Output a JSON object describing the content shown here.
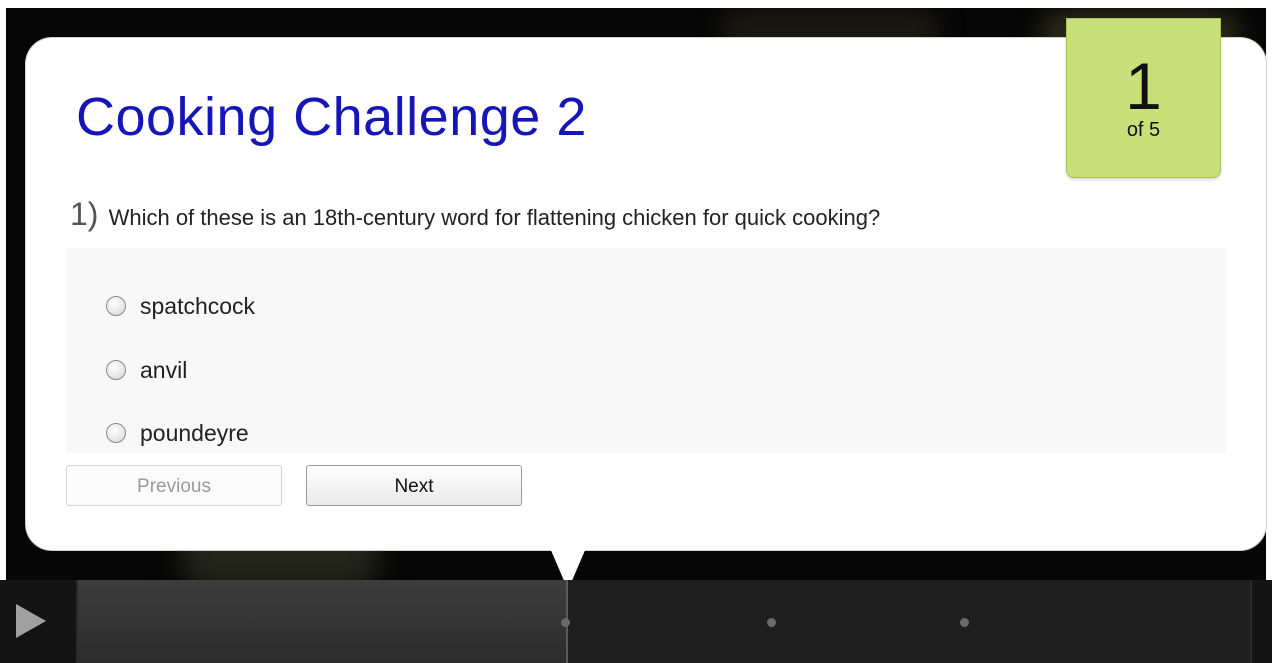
{
  "quiz": {
    "title": "Cooking Challenge 2",
    "counter": {
      "current": "1",
      "total_label": "of 5"
    },
    "question": {
      "number": "1)",
      "text": "Which of these is an 18th-century word for flattening chicken for quick cooking?"
    },
    "options": [
      "spatchcock",
      "anvil",
      "poundeyre"
    ],
    "buttons": {
      "previous": "Previous",
      "next": "Next"
    }
  },
  "timeline": {
    "progress": 0.416,
    "colors": {
      "accent": "#c8e07a",
      "title": "#1515b8"
    }
  }
}
